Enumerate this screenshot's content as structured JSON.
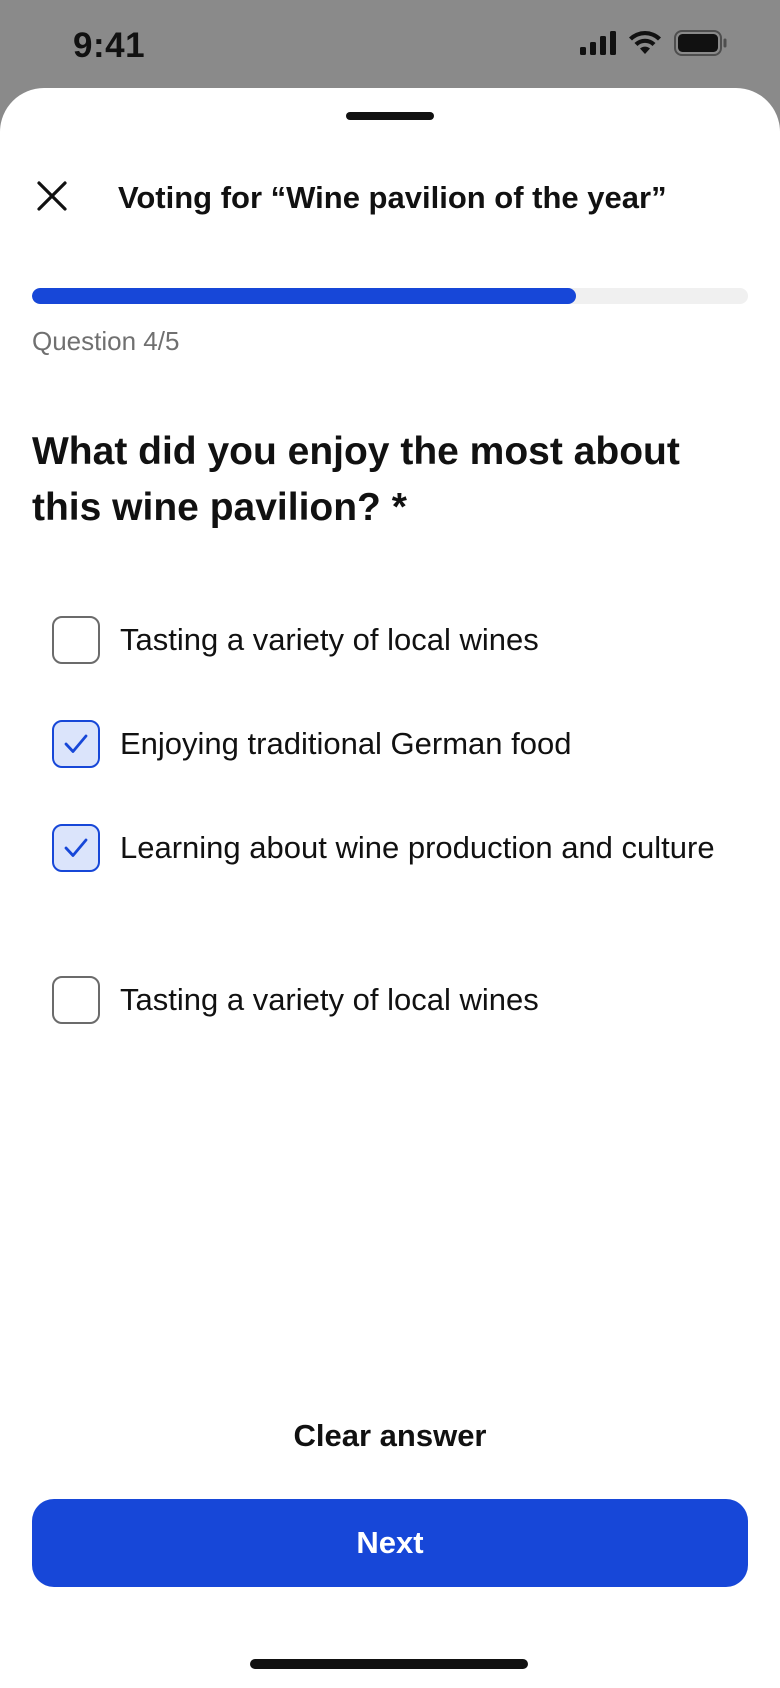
{
  "status_bar": {
    "time": "9:41",
    "icons": [
      "cellular-signal-icon",
      "wifi-icon",
      "battery-icon"
    ]
  },
  "sheet": {
    "title": "Voting for “Wine pavilion of the year”",
    "close_icon": "close-icon"
  },
  "progress": {
    "current": 4,
    "total": 5,
    "fraction": 0.76,
    "label": "Question 4/5",
    "color": "#1747d8"
  },
  "question": {
    "text": "What did you enjoy the most about this wine pavilion? *"
  },
  "options": [
    {
      "label": "Tasting a variety of local wines",
      "checked": false
    },
    {
      "label": "Enjoying traditional German food",
      "checked": true
    },
    {
      "label": "Learning about wine production and culture",
      "checked": true
    },
    {
      "label": "Tasting a variety of local wines",
      "checked": false
    }
  ],
  "actions": {
    "clear_label": "Clear answer",
    "next_label": "Next"
  },
  "colors": {
    "accent": "#1747d8",
    "checked_fill": "#dbe4fb",
    "backdrop": "#8a8a8a"
  }
}
